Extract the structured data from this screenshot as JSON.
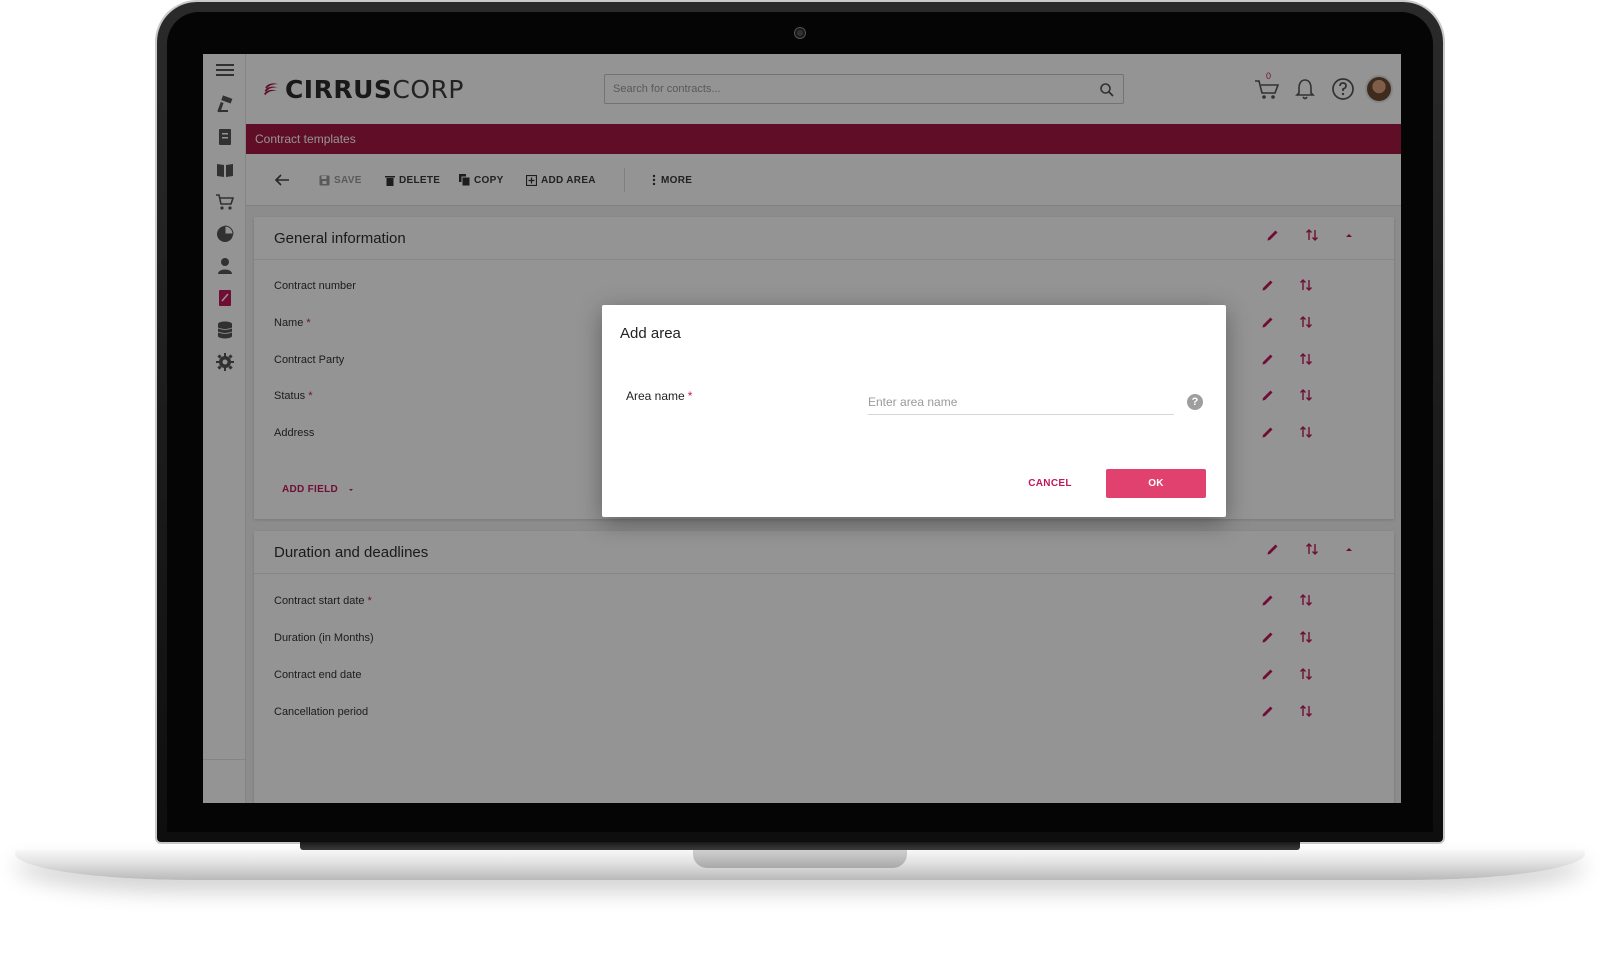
{
  "app": {
    "brand": {
      "bold": "CIRRUS",
      "light": "CORP"
    },
    "search": {
      "placeholder": "Search for contracts..."
    },
    "cart_count": "0",
    "page_title": "Contract templates"
  },
  "toolbar": {
    "save": "SAVE",
    "delete": "DELETE",
    "copy": "COPY",
    "add_area": "ADD AREA",
    "more": "MORE"
  },
  "sections": [
    {
      "title": "General information",
      "fields": [
        {
          "label": "Contract number",
          "required": ""
        },
        {
          "label": "Name",
          "required": "*"
        },
        {
          "label": "Contract Party",
          "required": ""
        },
        {
          "label": "Status",
          "required": "*"
        },
        {
          "label": "Address",
          "required": ""
        }
      ],
      "add_field": "ADD FIELD"
    },
    {
      "title": "Duration and deadlines",
      "fields": [
        {
          "label": "Contract start date",
          "required": "*"
        },
        {
          "label": "Duration (in Months)",
          "required": ""
        },
        {
          "label": "Contract end date",
          "required": ""
        },
        {
          "label": "Cancellation period",
          "required": ""
        }
      ]
    }
  ],
  "dialog": {
    "title": "Add area",
    "label": "Area name",
    "required": "*",
    "placeholder": "Enter area name",
    "help": "?",
    "cancel": "CANCEL",
    "ok": "OK"
  },
  "colors": {
    "accent": "#a51844",
    "accent_text": "#c2185b",
    "ok_button": "#e0416f"
  },
  "icons": {
    "sidebar": [
      "menu-icon",
      "hammer-icon",
      "contract-document-icon",
      "book-icon",
      "cart-icon",
      "pie-chart-icon",
      "person-icon",
      "active-document-icon",
      "database-icon",
      "gear-icon"
    ],
    "top": [
      "cart-icon",
      "bell-icon",
      "help-icon",
      "avatar"
    ],
    "row_actions": [
      "pencil-icon",
      "sort-arrows-icon"
    ]
  }
}
